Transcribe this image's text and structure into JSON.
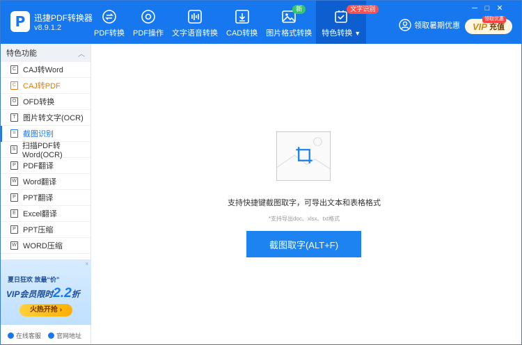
{
  "app": {
    "name": "迅捷PDF转换器",
    "version": "v8.9.1.2",
    "logo_letter": "P"
  },
  "nav": [
    {
      "label": "PDF转换",
      "icon": "pdf-convert-icon"
    },
    {
      "label": "PDF操作",
      "icon": "pdf-operate-icon"
    },
    {
      "label": "文字语音转换",
      "icon": "audio-wave-icon"
    },
    {
      "label": "CAD转换",
      "icon": "cad-download-icon"
    },
    {
      "label": "图片格式转换",
      "icon": "image-icon",
      "badge": "新"
    },
    {
      "label": "特色转换",
      "icon": "special-convert-icon",
      "badge": "文字识别",
      "active": true
    }
  ],
  "header_right": {
    "promo_text": "领取暑期优惠",
    "vip_label": "VIP",
    "vip_action": "充值",
    "vip_tag": "领取优惠"
  },
  "window_controls": [
    "─",
    "□",
    "✕"
  ],
  "sidebar": {
    "section_title": "特色功能",
    "items": [
      {
        "label": "CAJ转Word",
        "icon_text": "C"
      },
      {
        "label": "CAJ转PDF",
        "icon_text": "C",
        "highlight": "orange"
      },
      {
        "label": "OFD转换",
        "icon_text": "O"
      },
      {
        "label": "图片转文字(OCR)",
        "icon_text": "T"
      },
      {
        "label": "截图识别",
        "icon_text": "⌗",
        "selected": true
      },
      {
        "label": "扫描PDF转Word(OCR)",
        "icon_text": "S"
      },
      {
        "label": "PDF翻译",
        "icon_text": "P"
      },
      {
        "label": "Word翻译",
        "icon_text": "W"
      },
      {
        "label": "PPT翻译",
        "icon_text": "P"
      },
      {
        "label": "Excel翻译",
        "icon_text": "E"
      },
      {
        "label": "PPT压缩",
        "icon_text": "P"
      },
      {
        "label": "WORD压缩",
        "icon_text": "W"
      }
    ],
    "ad": {
      "close": "×",
      "line1": "夏日狂欢 放最“价”",
      "line2_prefix": "VIP会员限时",
      "line2_number": "2.2",
      "line2_suffix": "折",
      "button": "火热开抢 ›"
    },
    "footer": {
      "service": "在线客服",
      "website": "官网地址"
    }
  },
  "main": {
    "description": "支持快捷键截图取字，可导出文本和表格格式",
    "hint": "*支持导出doc、xlsx、txt格式",
    "capture_button": "截图取字(ALT+F)"
  },
  "colors": {
    "header_blue": "#1677ee",
    "active_tab": "#0d5fd0",
    "badge_green": "#36c66b",
    "badge_red": "#ff5050",
    "accent_orange": "#e07d10"
  }
}
